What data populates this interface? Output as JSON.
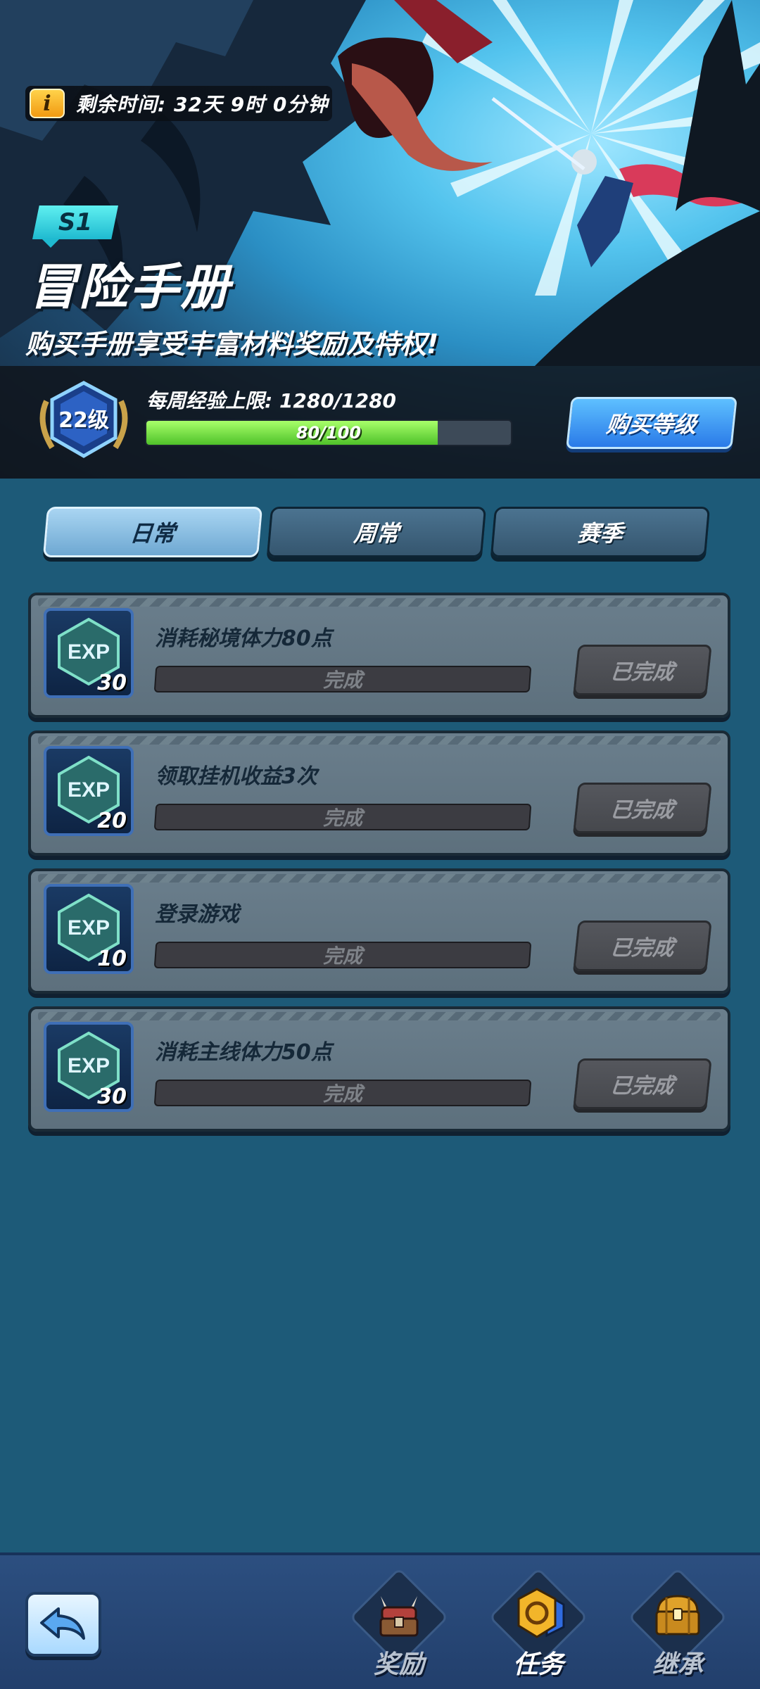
{
  "header": {
    "timer_icon_glyph": "i",
    "remaining_time": "剩余时间: 32天 9时 0分钟",
    "season_tag": "S1",
    "title": "冒险手册",
    "subtitle": "购买手册享受丰富材料奖励及特权!"
  },
  "level": {
    "badge_text": "22级",
    "weekly_exp_limit": "每周经验上限: 1280/1280",
    "progress_text": "80/100",
    "progress_fraction": 0.8,
    "buy_button": "购买等级"
  },
  "tabs": [
    {
      "label": "日常",
      "active": true
    },
    {
      "label": "周常",
      "active": false
    },
    {
      "label": "赛季",
      "active": false
    }
  ],
  "tasks": [
    {
      "exp_label": "EXP",
      "exp": "30",
      "name": "消耗秘境体力80点",
      "progress_text": "完成",
      "button": "已完成"
    },
    {
      "exp_label": "EXP",
      "exp": "20",
      "name": "领取挂机收益3次",
      "progress_text": "完成",
      "button": "已完成"
    },
    {
      "exp_label": "EXP",
      "exp": "10",
      "name": "登录游戏",
      "progress_text": "完成",
      "button": "已完成"
    },
    {
      "exp_label": "EXP",
      "exp": "30",
      "name": "消耗主线体力50点",
      "progress_text": "完成",
      "button": "已完成"
    }
  ],
  "bottom_nav": {
    "items": [
      {
        "label": "奖励",
        "icon": "horned-chest-icon",
        "active": false
      },
      {
        "label": "任务",
        "icon": "quest-badge-icon",
        "active": true
      },
      {
        "label": "继承",
        "icon": "treasure-chest-icon",
        "active": false
      }
    ]
  },
  "colors": {
    "background": "#1d5a78",
    "progress_green": "#4fc22a",
    "buy_button_blue": "#2a7ae8",
    "active_tab": "#6ea8d2",
    "done_button_gray": "#46484d"
  }
}
